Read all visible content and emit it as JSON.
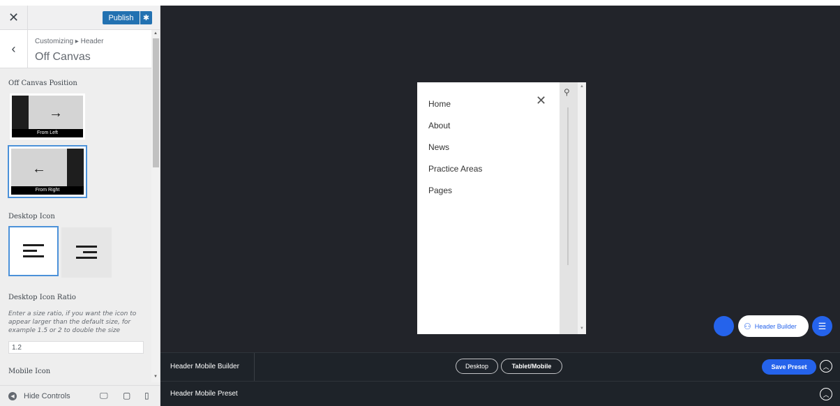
{
  "topbar": {
    "close_glyph": "✕",
    "publish_label": "Publish",
    "settings_glyph": "✱"
  },
  "section": {
    "back_glyph": "‹",
    "breadcrumb": "Customizing ▸ Header",
    "title": "Off Canvas"
  },
  "controls": {
    "position_title": "Off Canvas Position",
    "positions": [
      {
        "label": "From Left",
        "arrow": "→",
        "selected": false
      },
      {
        "label": "From Right",
        "arrow": "←",
        "selected": true
      }
    ],
    "desktop_icon_title": "Desktop Icon",
    "desktop_icon_options": [
      {
        "style": "left-aligned",
        "selected": true
      },
      {
        "style": "right-aligned",
        "selected": false
      }
    ],
    "ratio_title": "Desktop Icon Ratio",
    "ratio_description": "Enter a size ratio, if you want the icon to appear larger than the default size, for example 1.5 or 2 to double the size",
    "ratio_value": "1.2",
    "mobile_icon_title": "Mobile Icon"
  },
  "footer": {
    "hide_label": "Hide Controls",
    "devices": [
      "desktop-icon",
      "tablet-icon",
      "mobile-icon"
    ]
  },
  "preview": {
    "menu_items": [
      "Home",
      "About",
      "News",
      "Practice Areas",
      "Pages"
    ],
    "close_glyph": "✕",
    "search_glyph": "⚲",
    "header_builder_label": "Header Builder"
  },
  "builder": {
    "title": "Header Mobile Builder",
    "devices": [
      "Desktop",
      "Tablet/Mobile"
    ],
    "active_device": "Tablet/Mobile",
    "save_label": "Save Preset",
    "chevron_glyph": "︿",
    "preset_title": "Header Mobile Preset"
  },
  "colors": {
    "accent": "#2563eb",
    "wp_blue": "#2271b1",
    "preview_bg": "#22242a",
    "bar_bg": "#1e2329"
  }
}
